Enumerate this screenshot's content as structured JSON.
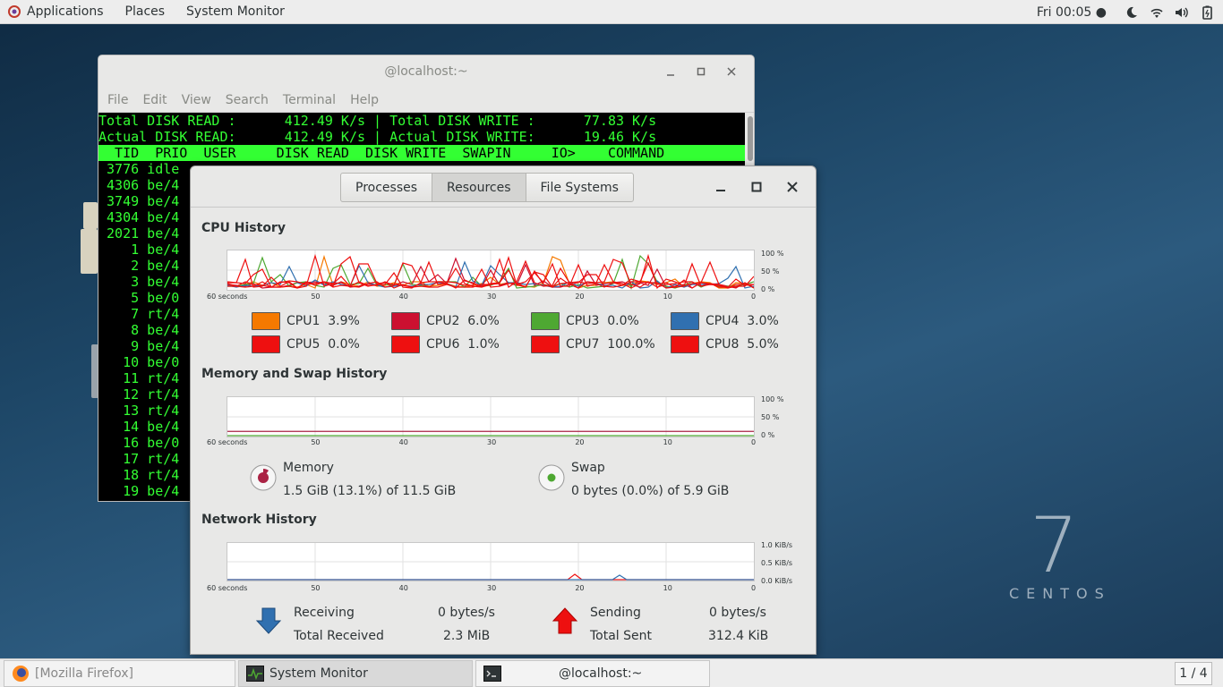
{
  "topbar": {
    "applications": "Applications",
    "places": "Places",
    "app_name": "System Monitor",
    "clock": "Fri 00:05 ●",
    "icons": [
      "night-mode-icon",
      "wifi-icon",
      "volume-icon",
      "battery-icon"
    ]
  },
  "desktop": {
    "version": "7",
    "brand": "CENTOS"
  },
  "terminal": {
    "title": "@localhost:~",
    "menu": [
      "File",
      "Edit",
      "View",
      "Search",
      "Terminal",
      "Help"
    ],
    "lines": [
      "Total DISK READ :      412.49 K/s | Total DISK WRITE :      77.83 K/s",
      "Actual DISK READ:      412.49 K/s | Actual DISK WRITE:      19.46 K/s",
      "  TID  PRIO  USER     DISK READ  DISK WRITE  SWAPIN     IO>    COMMAND",
      " 3776 idle",
      " 4306 be/4",
      " 3749 be/4",
      " 4304 be/4",
      " 2021 be/4",
      "    1 be/4",
      "    2 be/4",
      "    3 be/4",
      "    5 be/0",
      "    7 rt/4",
      "    8 be/4",
      "    9 be/4",
      "   10 be/0",
      "   11 rt/4",
      "   12 rt/4",
      "   13 rt/4",
      "   14 be/4",
      "   16 be/0",
      "   17 rt/4",
      "   18 rt/4",
      "   19 be/4"
    ]
  },
  "sysmon": {
    "tabs": [
      "Processes",
      "Resources",
      "File Systems"
    ],
    "active_tab": "Resources",
    "cpu": {
      "title": "CPU History",
      "y_labels": [
        "100 %",
        "50 %",
        "0 %"
      ],
      "x_labels": [
        "60 seconds",
        "50",
        "40",
        "30",
        "20",
        "10",
        "0"
      ],
      "legend": [
        {
          "label": "CPU1",
          "value": "3.9%",
          "color": "#f57900"
        },
        {
          "label": "CPU2",
          "value": "6.0%",
          "color": "#cc1030"
        },
        {
          "label": "CPU3",
          "value": "0.0%",
          "color": "#4ea832"
        },
        {
          "label": "CPU4",
          "value": "3.0%",
          "color": "#3070b0"
        },
        {
          "label": "CPU5",
          "value": "0.0%",
          "color": "#ee1010"
        },
        {
          "label": "CPU6",
          "value": "1.0%",
          "color": "#ee1010"
        },
        {
          "label": "CPU7",
          "value": "100.0%",
          "color": "#ee1010"
        },
        {
          "label": "CPU8",
          "value": "5.0%",
          "color": "#ee1010"
        }
      ]
    },
    "memory": {
      "title": "Memory and Swap History",
      "y_labels": [
        "100 %",
        "50 %",
        "0 %"
      ],
      "x_labels": [
        "60 seconds",
        "50",
        "40",
        "30",
        "20",
        "10",
        "0"
      ],
      "mem_label": "Memory",
      "mem_value": "1.5 GiB (13.1%) of 11.5 GiB",
      "swap_label": "Swap",
      "swap_value": "0 bytes (0.0%) of 5.9 GiB",
      "mem_color": "#aa2244",
      "swap_color": "#4ea832"
    },
    "network": {
      "title": "Network History",
      "y_labels": [
        "1.0 KiB/s",
        "0.5 KiB/s",
        "0.0 KiB/s"
      ],
      "x_labels": [
        "60 seconds",
        "50",
        "40",
        "30",
        "20",
        "10",
        "0"
      ],
      "receiving_label": "Receiving",
      "receiving_value": "0 bytes/s",
      "total_received_label": "Total Received",
      "total_received_value": "2.3 MiB",
      "sending_label": "Sending",
      "sending_value": "0 bytes/s",
      "total_sent_label": "Total Sent",
      "total_sent_value": "312.4 KiB",
      "recv_color": "#3070b0",
      "send_color": "#ee1010"
    }
  },
  "taskbar": {
    "items": [
      "[Mozilla Firefox]",
      "System Monitor",
      "@localhost:~"
    ],
    "workspace": "1 / 4"
  }
}
